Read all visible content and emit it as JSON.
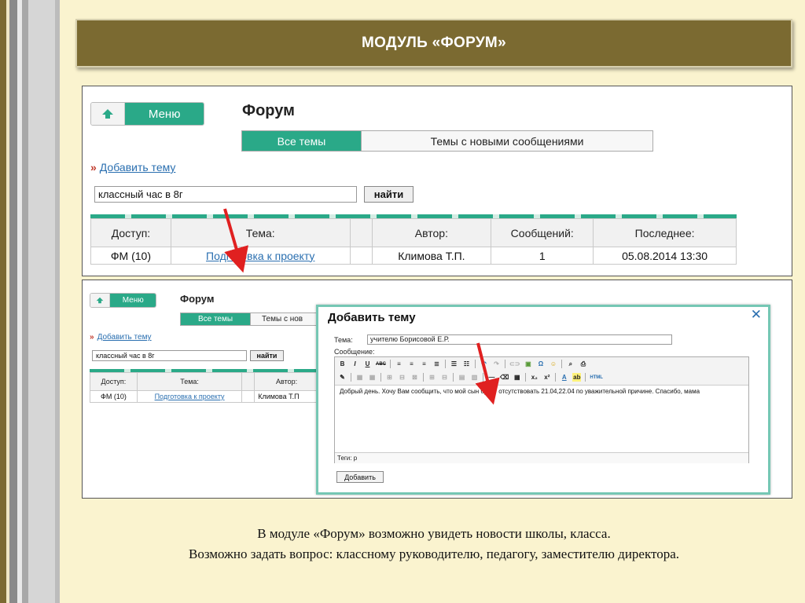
{
  "slide": {
    "title": "МОДУЛЬ «ФОРУМ»",
    "caption_line1": "В модуле «Форум» возможно увидеть новости школы, класса.",
    "caption_line2": "Возможно задать вопрос: классному руководителю, педагогу, заместителю директора.",
    "colors": {
      "background": "#faf3cf",
      "title_bar": "#7b6a31",
      "accent": "#2aa988",
      "arrow": "#e02020"
    }
  },
  "forum": {
    "menu_label": "Меню",
    "title": "Форум",
    "tabs": [
      "Все темы",
      "Темы с новыми сообщениями"
    ],
    "add_topic_link": "Добавить тему",
    "raquo": "»",
    "search_value": "классный час в 8г",
    "search_button": "найти",
    "table": {
      "headers": [
        "Доступ:",
        "Тема:",
        "",
        "Автор:",
        "Сообщений:",
        "Последнее:"
      ],
      "rows": [
        {
          "access": "ФМ (10)",
          "topic": "Подготовка к проекту",
          "author": "Климова Т.П.",
          "messages": "1",
          "last": "05.08.2014 13:30"
        }
      ]
    }
  },
  "forum_small": {
    "tab2_partial": "Темы с нов",
    "author_partial": "Климова Т.П"
  },
  "dialog": {
    "title": "Добавить тему",
    "close_glyph": "✕",
    "topic_label": "Тема:",
    "topic_value": "учителю Борисовой Е.Р.",
    "message_label": "Сообщение:",
    "message_text": "Добрый день. Хочу Вам сообщить, что мой сын будет отсутствовать 21.04,22.04 по уважительной причине. Спасибо, мама",
    "tags_label": "Теги: p",
    "submit_label": "Добавить",
    "toolbar_row1": [
      "B",
      "I",
      "U",
      "ABC",
      "Ω",
      "☺"
    ],
    "toolbar_row2": [
      "—",
      "x₂",
      "x²",
      "A",
      "HTML"
    ]
  }
}
